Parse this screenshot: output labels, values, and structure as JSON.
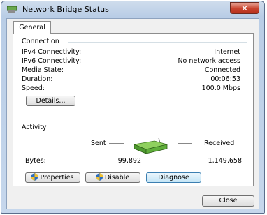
{
  "window": {
    "title": "Network Bridge Status",
    "close_glyph": "✕"
  },
  "tabs": [
    {
      "label": "General"
    }
  ],
  "connection": {
    "heading": "Connection",
    "rows": [
      {
        "label": "IPv4 Connectivity:",
        "value": "Internet"
      },
      {
        "label": "IPv6 Connectivity:",
        "value": "No network access"
      },
      {
        "label": "Media State:",
        "value": "Connected"
      },
      {
        "label": "Duration:",
        "value": "00:06:53"
      },
      {
        "label": "Speed:",
        "value": "100.0 Mbps"
      }
    ],
    "details_button": "Details..."
  },
  "activity": {
    "heading": "Activity",
    "sent_label": "Sent",
    "received_label": "Received",
    "bytes_label": "Bytes:",
    "bytes_sent": "99,892",
    "bytes_received": "1,149,658"
  },
  "buttons": {
    "properties": "Properties",
    "disable": "Disable",
    "diagnose": "Diagnose",
    "close": "Close"
  },
  "colors": {
    "accent": "#3c7fb1",
    "shield_blue": "#2a6cc0",
    "shield_yellow": "#f2c12e",
    "router_green": "#4e9a2f"
  }
}
